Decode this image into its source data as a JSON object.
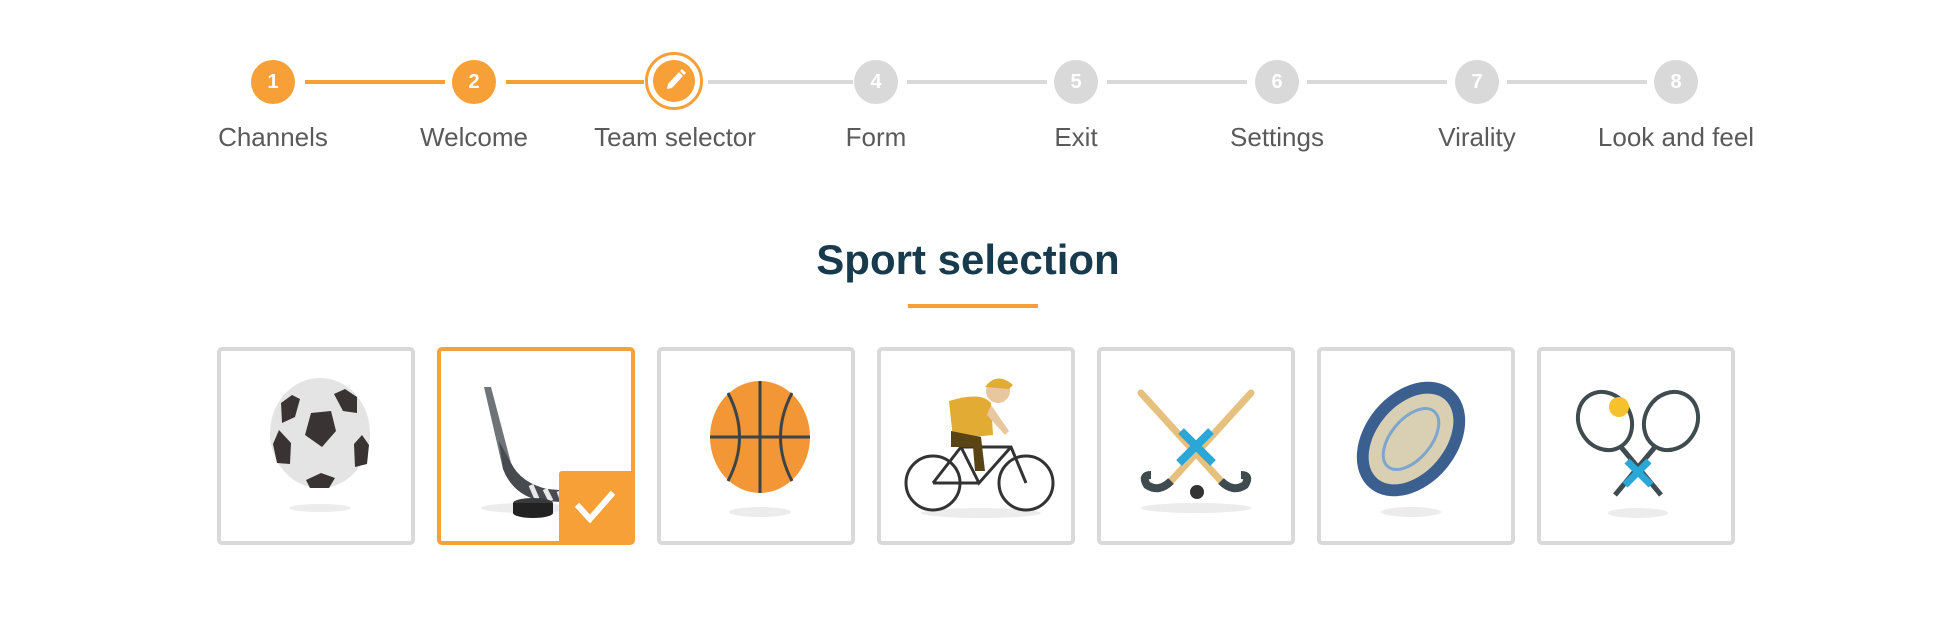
{
  "stepper": {
    "steps": [
      {
        "number": "1",
        "label": "Channels",
        "state": "done"
      },
      {
        "number": "2",
        "label": "Welcome",
        "state": "done"
      },
      {
        "number": "",
        "label": "Team selector",
        "state": "current",
        "icon": "pencil-icon"
      },
      {
        "number": "4",
        "label": "Form",
        "state": "todo"
      },
      {
        "number": "5",
        "label": "Exit",
        "state": "todo"
      },
      {
        "number": "6",
        "label": "Settings",
        "state": "todo"
      },
      {
        "number": "7",
        "label": "Virality",
        "state": "todo"
      },
      {
        "number": "8",
        "label": "Look and feel",
        "state": "todo"
      }
    ]
  },
  "main": {
    "title": "Sport selection",
    "sports": [
      {
        "icon": "soccer-ball-icon",
        "selected": false
      },
      {
        "icon": "ice-hockey-icon",
        "selected": true
      },
      {
        "icon": "basketball-icon",
        "selected": false
      },
      {
        "icon": "cycling-icon",
        "selected": false
      },
      {
        "icon": "field-hockey-icon",
        "selected": false
      },
      {
        "icon": "rugby-ball-icon",
        "selected": false
      },
      {
        "icon": "tennis-icon",
        "selected": false
      }
    ]
  },
  "colors": {
    "accent": "#f7a038",
    "inactive": "#d9d9d9",
    "title": "#173a4c",
    "label": "#5a5a5a"
  }
}
